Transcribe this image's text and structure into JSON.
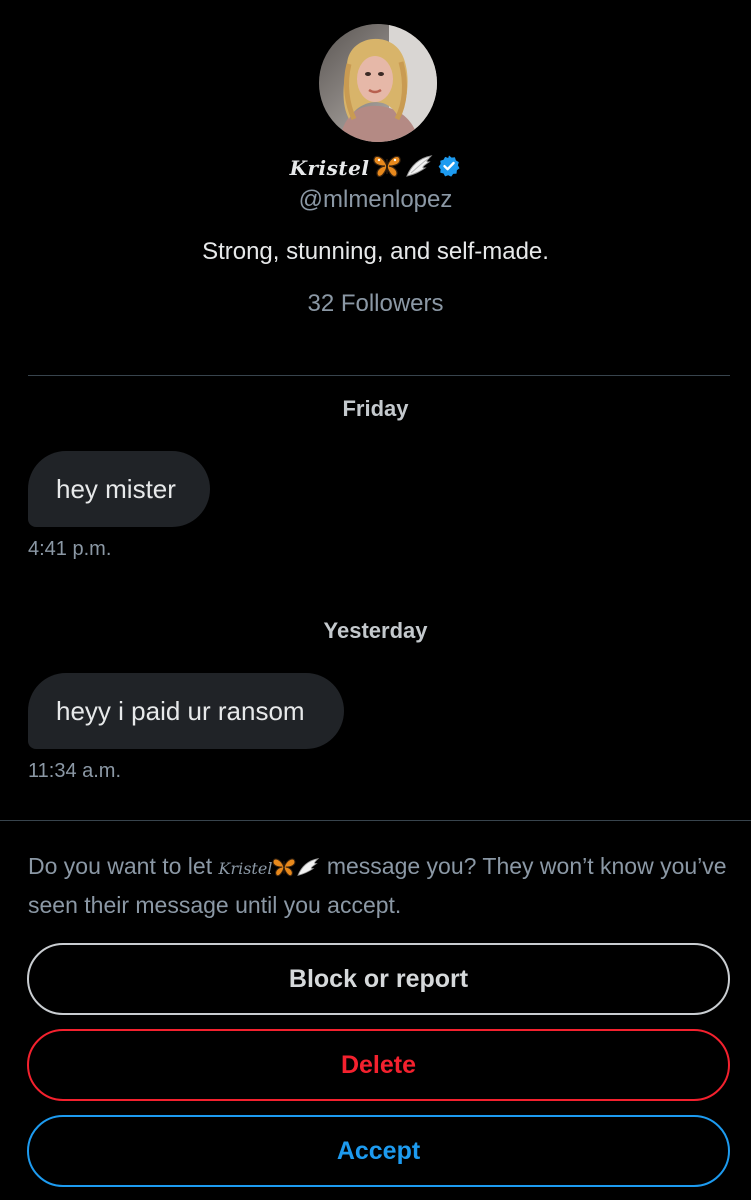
{
  "profile": {
    "display_name": "Kristel",
    "name_emojis": [
      "butterfly-icon",
      "wing-icon"
    ],
    "verified": true,
    "handle": "@mlmenlopez",
    "bio": "Strong, stunning, and self-made.",
    "followers": "32 Followers"
  },
  "conversation": [
    {
      "day": "Friday",
      "message": "hey mister",
      "time": "4:41 p.m."
    },
    {
      "day": "Yesterday",
      "message": "heyy i paid ur ransom",
      "time": "11:34 a.m."
    }
  ],
  "request": {
    "text_before": "Do you want to let ",
    "name": "Kristel",
    "text_after": " message you? They won’t know you’ve seen their message until you accept."
  },
  "actions": {
    "block_label": "Block or report",
    "delete_label": "Delete",
    "accept_label": "Accept"
  },
  "colors": {
    "background": "#000000",
    "bubble": "#202327",
    "muted_text": "#8b98a5",
    "delete_red": "#f4212e",
    "accept_blue": "#1d9bf0",
    "verified_blue": "#1d9bf0"
  }
}
